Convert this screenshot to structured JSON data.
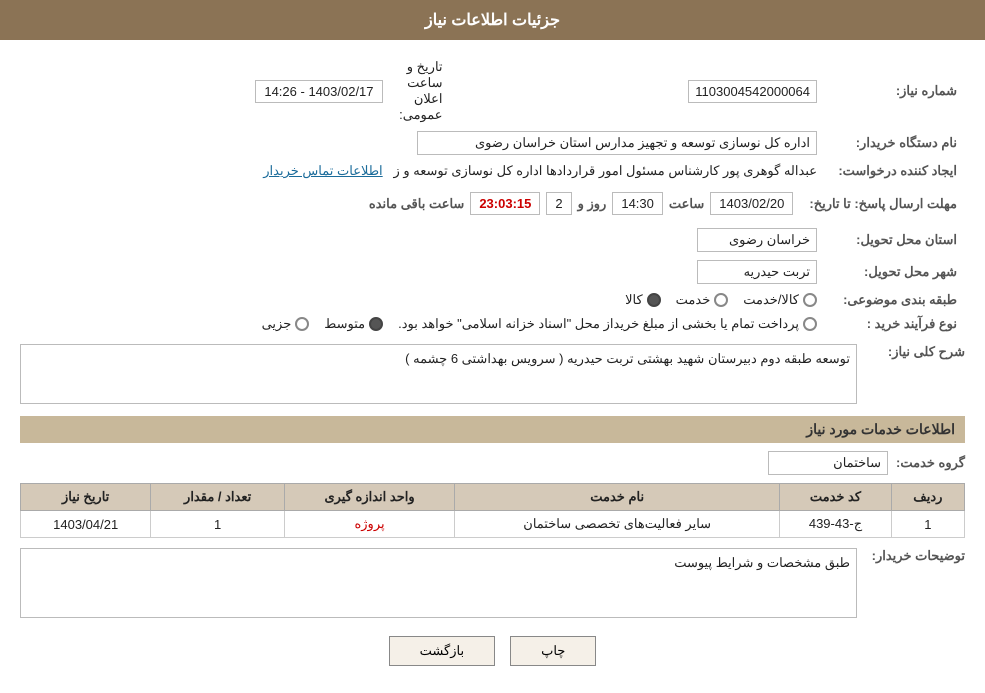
{
  "header": {
    "title": "جزئیات اطلاعات نیاز"
  },
  "fields": {
    "need_number_label": "شماره نیاز:",
    "need_number_value": "1103004542000064",
    "buyer_org_label": "نام دستگاه خریدار:",
    "buyer_org_value": "اداره کل نوسازی  توسعه و تجهیز مدارس استان خراسان رضوی",
    "creator_label": "ایجاد کننده درخواست:",
    "creator_value": "عبداله گوهری پور کارشناس مسئول امور قراردادها  اداره کل نوسازی  توسعه و ز",
    "creator_link": "اطلاعات تماس خریدار",
    "send_date_label": "مهلت ارسال پاسخ: تا تاریخ:",
    "announce_datetime_label": "تاریخ و ساعت اعلان عمومی:",
    "announce_datetime_value": "1403/02/17 - 14:26",
    "deadline_date_value": "1403/02/20",
    "deadline_time_label": "ساعت",
    "deadline_time_value": "14:30",
    "deadline_day_label": "روز و",
    "deadline_day_value": "2",
    "deadline_remain_label": "ساعت باقی مانده",
    "deadline_remain_value": "23:03:15",
    "province_label": "استان محل تحویل:",
    "province_value": "خراسان رضوی",
    "city_label": "شهر محل تحویل:",
    "city_value": "تربت حیدریه",
    "category_label": "طبقه بندی موضوعی:",
    "category_options": [
      {
        "label": "کالا",
        "selected": true
      },
      {
        "label": "خدمت",
        "selected": false
      },
      {
        "label": "کالا/خدمت",
        "selected": false
      }
    ],
    "purchase_type_label": "نوع فرآیند خرید :",
    "purchase_type_options": [
      {
        "label": "جزیی",
        "selected": false
      },
      {
        "label": "متوسط",
        "selected": true
      },
      {
        "label": "پرداخت تمام یا بخشی از مبلغ خریداز محل \"اسناد خزانه اسلامی\" خواهد بود.",
        "selected": false
      }
    ],
    "general_desc_label": "شرح کلی نیاز:",
    "general_desc_value": "توسعه طبقه دوم دبیرستان شهید بهشتی تربت حیدریه ( سرویس بهداشتی 6 چشمه )",
    "services_label": "اطلاعات خدمات مورد نیاز",
    "group_service_label": "گروه خدمت:",
    "group_service_value": "ساختمان",
    "table_headers": [
      "ردیف",
      "کد خدمت",
      "نام خدمت",
      "واحد اندازه گیری",
      "تعداد / مقدار",
      "تاریخ نیاز"
    ],
    "table_rows": [
      {
        "row": "1",
        "code": "ج-43-439",
        "name": "سایر فعالیت‌های تخصصی ساختمان",
        "unit": "پروژه",
        "quantity": "1",
        "date": "1403/04/21"
      }
    ],
    "buyer_desc_label": "توضیحات خریدار:",
    "buyer_desc_value": "طبق مشخصات و شرایط پیوست",
    "btn_print": "چاپ",
    "btn_back": "بازگشت"
  }
}
